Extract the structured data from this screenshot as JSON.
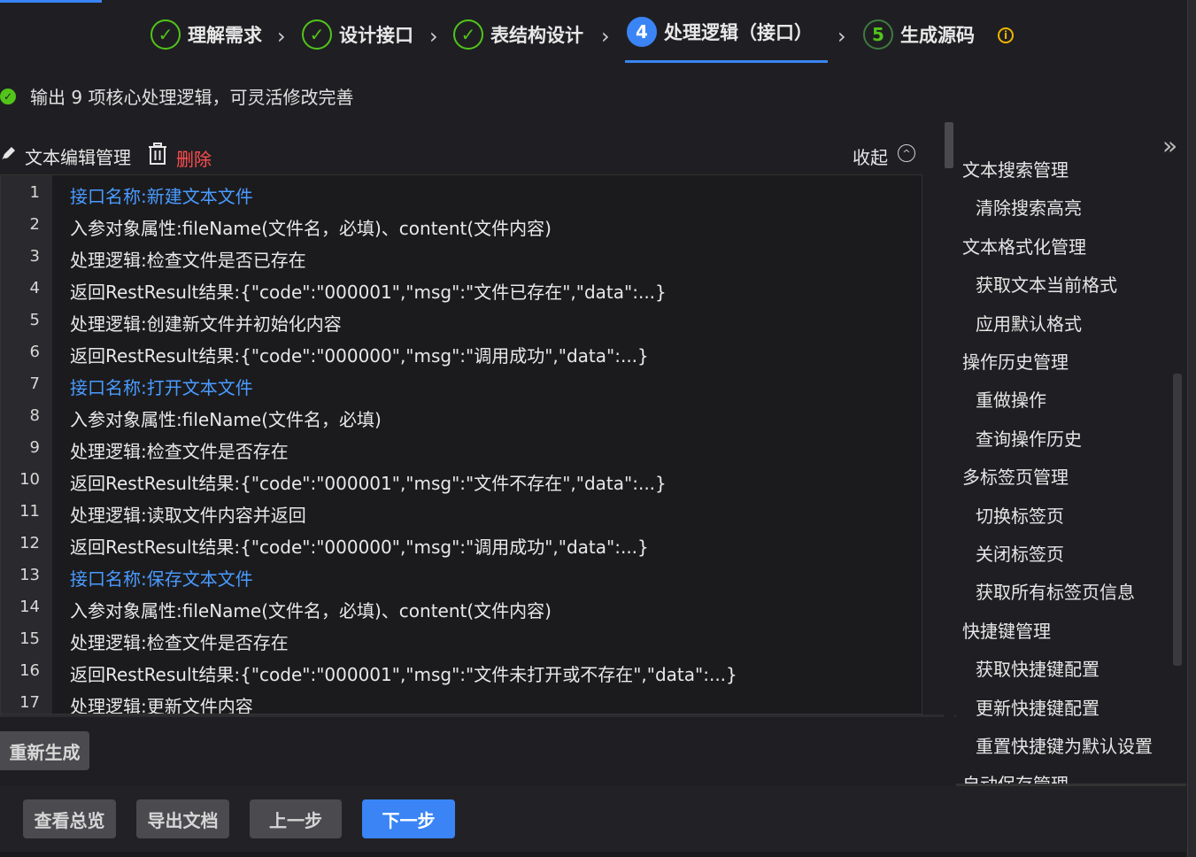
{
  "steps": [
    {
      "label": "理解需求",
      "marker": "✓",
      "state": "done"
    },
    {
      "label": "设计接口",
      "marker": "✓",
      "state": "done"
    },
    {
      "label": "表结构设计",
      "marker": "✓",
      "state": "done"
    },
    {
      "label": "处理逻辑（接口）",
      "marker": "4",
      "state": "active"
    },
    {
      "label": "生成源码",
      "marker": "5",
      "state": "pending"
    }
  ],
  "status": {
    "message": "输出 9 项核心处理逻辑，可灵活修改完善"
  },
  "toolbar": {
    "title": "文本编辑管理",
    "delete_label": "删除",
    "collapse_label": "收起"
  },
  "editor": {
    "lines": [
      {
        "n": "1",
        "text": "接口名称:新建文本文件",
        "kind": "interface"
      },
      {
        "n": "2",
        "text": "入参对象属性:fileName(文件名，必填)、content(文件内容)",
        "kind": "normal"
      },
      {
        "n": "3",
        "text": "处理逻辑:检查文件是否已存在",
        "kind": "normal"
      },
      {
        "n": "4",
        "text": "返回RestResult结果:{\"code\":\"000001\",\"msg\":\"文件已存在\",\"data\":...}",
        "kind": "normal"
      },
      {
        "n": "5",
        "text": "处理逻辑:创建新文件并初始化内容",
        "kind": "normal"
      },
      {
        "n": "6",
        "text": "返回RestResult结果:{\"code\":\"000000\",\"msg\":\"调用成功\",\"data\":...}",
        "kind": "normal"
      },
      {
        "n": "7",
        "text": "接口名称:打开文本文件",
        "kind": "interface"
      },
      {
        "n": "8",
        "text": "入参对象属性:fileName(文件名，必填)",
        "kind": "normal"
      },
      {
        "n": "9",
        "text": "处理逻辑:检查文件是否存在",
        "kind": "normal"
      },
      {
        "n": "10",
        "text": "返回RestResult结果:{\"code\":\"000001\",\"msg\":\"文件不存在\",\"data\":...}",
        "kind": "normal"
      },
      {
        "n": "11",
        "text": "处理逻辑:读取文件内容并返回",
        "kind": "normal"
      },
      {
        "n": "12",
        "text": "返回RestResult结果:{\"code\":\"000000\",\"msg\":\"调用成功\",\"data\":...}",
        "kind": "normal"
      },
      {
        "n": "13",
        "text": "接口名称:保存文本文件",
        "kind": "interface"
      },
      {
        "n": "14",
        "text": "入参对象属性:fileName(文件名，必填)、content(文件内容)",
        "kind": "normal"
      },
      {
        "n": "15",
        "text": "处理逻辑:检查文件是否存在",
        "kind": "normal"
      },
      {
        "n": "16",
        "text": "返回RestResult结果:{\"code\":\"000001\",\"msg\":\"文件未打开或不存在\",\"data\":...}",
        "kind": "normal"
      },
      {
        "n": "17",
        "text": "处理逻辑:更新文件内容",
        "kind": "normal"
      }
    ]
  },
  "outline": {
    "items": [
      {
        "text": "文本搜索管理",
        "level": "group"
      },
      {
        "text": "清除搜索高亮",
        "level": "child"
      },
      {
        "text": "文本格式化管理",
        "level": "group"
      },
      {
        "text": "获取文本当前格式",
        "level": "child"
      },
      {
        "text": "应用默认格式",
        "level": "child"
      },
      {
        "text": "操作历史管理",
        "level": "group"
      },
      {
        "text": "重做操作",
        "level": "child"
      },
      {
        "text": "查询操作历史",
        "level": "child"
      },
      {
        "text": "多标签页管理",
        "level": "group"
      },
      {
        "text": "切换标签页",
        "level": "child"
      },
      {
        "text": "关闭标签页",
        "level": "child"
      },
      {
        "text": "获取所有标签页信息",
        "level": "child"
      },
      {
        "text": "快捷键管理",
        "level": "group"
      },
      {
        "text": "获取快捷键配置",
        "level": "child"
      },
      {
        "text": "更新快捷键配置",
        "level": "child"
      },
      {
        "text": "重置快捷键为默认设置",
        "level": "child"
      },
      {
        "text": "自动保存管理",
        "level": "group"
      }
    ]
  },
  "buttons": {
    "regenerate": "重新生成",
    "overview": "查看总览",
    "export": "导出文档",
    "prev": "上一步",
    "next": "下一步"
  },
  "icons": {
    "step_done": "check-circle-icon",
    "info": "info-icon",
    "status": "check-circle-icon",
    "edit": "edit-pen-icon",
    "delete": "trash-icon",
    "collapse": "chevron-up-circle-icon",
    "expand": "double-chevron-right-icon"
  },
  "colors": {
    "background": "#1f1f23",
    "accent": "#3a84f5",
    "success": "#52c41a",
    "danger": "#ff4d4f",
    "warning": "#f0b400",
    "interface_line": "#4a9bff"
  }
}
